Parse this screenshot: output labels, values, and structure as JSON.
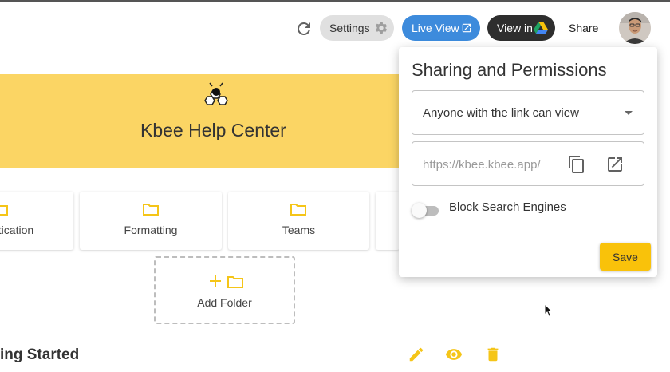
{
  "header": {
    "settings_label": "Settings",
    "live_view_label": "Live View",
    "view_in_label": "View in",
    "share_label": "Share"
  },
  "banner": {
    "title": "Kbee Help Center"
  },
  "folders": [
    {
      "label": "ntication"
    },
    {
      "label": "Formatting"
    },
    {
      "label": "Teams"
    },
    {
      "label": ""
    }
  ],
  "add_folder": {
    "label": "Add Folder"
  },
  "section": {
    "title": "ing Started"
  },
  "sharing": {
    "title": "Sharing and Permissions",
    "permission_selected": "Anyone with the link can view",
    "link_value": "https://kbee.kbee.app/",
    "block_search_label": "Block Search Engines",
    "block_search_on": false,
    "save_label": "Save"
  },
  "colors": {
    "banner": "#fbd564",
    "accent": "#f9c20a",
    "live_view": "#3d8bdc",
    "icon_yellow": "#f5c518"
  },
  "icons": [
    "refresh-icon",
    "gear-icon",
    "external-link-icon",
    "google-drive-icon",
    "bee-logo-icon",
    "folder-icon",
    "plus-icon",
    "copy-icon",
    "open-in-new-icon",
    "edit-icon",
    "eye-icon",
    "trash-icon"
  ]
}
